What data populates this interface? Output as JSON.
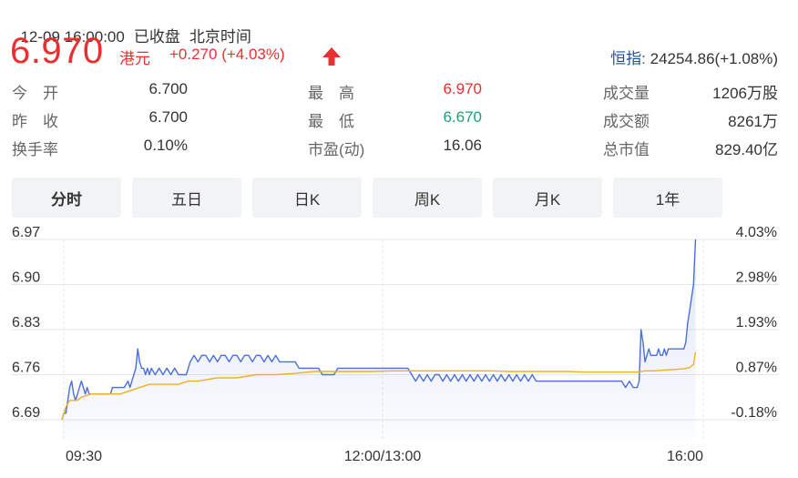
{
  "header": {
    "datetime": "12-09 16:00:00",
    "status": "已收盘",
    "timezone": "北京时间"
  },
  "quote": {
    "price": "6.970",
    "currency": "港元",
    "change": "+0.270 (+4.03%)",
    "direction": "up",
    "index_label": "恒指:",
    "index_value": "24254.86(+1.08%)"
  },
  "stats": [
    {
      "label": "今　开",
      "value": "6.700",
      "color": "#333333"
    },
    {
      "label": "昨　收",
      "value": "6.700",
      "color": "#333333"
    },
    {
      "label": "换手率",
      "value": "0.10%",
      "color": "#333333"
    },
    {
      "label": "最　高",
      "value": "6.970",
      "color": "#e93030"
    },
    {
      "label": "最　低",
      "value": "6.670",
      "color": "#1aa27b"
    },
    {
      "label": "市盈(动)",
      "value": "16.06",
      "color": "#333333"
    },
    {
      "label": "成交量",
      "value": "1206万股",
      "color": "#333333"
    },
    {
      "label": "成交额",
      "value": "8261万",
      "color": "#333333"
    },
    {
      "label": "总市值",
      "value": "829.40亿",
      "color": "#333333"
    }
  ],
  "tabs": [
    {
      "label": "分时",
      "active": true
    },
    {
      "label": "五日",
      "active": false
    },
    {
      "label": "日K",
      "active": false
    },
    {
      "label": "周K",
      "active": false
    },
    {
      "label": "月K",
      "active": false
    },
    {
      "label": "1年",
      "active": false
    }
  ],
  "colors": {
    "up": "#e93030",
    "down": "#1aa27b",
    "price_line": "#4a6fdc",
    "avg_line": "#f2b01e",
    "grid": "#e6e6e6"
  },
  "chart_data": {
    "type": "line",
    "y_ticks_left": [
      "6.97",
      "6.90",
      "6.83",
      "6.76",
      "6.69"
    ],
    "y_ticks_right": [
      "4.03%",
      "2.98%",
      "1.93%",
      "0.87%",
      "-0.18%"
    ],
    "ylim": [
      6.69,
      6.97
    ],
    "x_ticks": [
      "09:30",
      "12:00/13:00",
      "16:00"
    ],
    "x_range_minutes": [
      0,
      330
    ],
    "grid": true,
    "series": [
      {
        "role": "price",
        "points": [
          [
            0,
            6.69
          ],
          [
            1,
            6.7
          ],
          [
            2,
            6.7
          ],
          [
            3,
            6.72
          ],
          [
            4,
            6.74
          ],
          [
            5,
            6.75
          ],
          [
            6,
            6.73
          ],
          [
            7,
            6.72
          ],
          [
            8,
            6.73
          ],
          [
            9,
            6.74
          ],
          [
            10,
            6.75
          ],
          [
            11,
            6.74
          ],
          [
            12,
            6.73
          ],
          [
            13,
            6.74
          ],
          [
            14,
            6.73
          ],
          [
            15,
            6.73
          ],
          [
            18,
            6.73
          ],
          [
            20,
            6.73
          ],
          [
            22,
            6.73
          ],
          [
            25,
            6.73
          ],
          [
            26,
            6.74
          ],
          [
            28,
            6.74
          ],
          [
            30,
            6.74
          ],
          [
            32,
            6.74
          ],
          [
            34,
            6.75
          ],
          [
            35,
            6.74
          ],
          [
            36,
            6.75
          ],
          [
            37,
            6.76
          ],
          [
            38,
            6.77
          ],
          [
            39,
            6.8
          ],
          [
            40,
            6.78
          ],
          [
            41,
            6.77
          ],
          [
            42,
            6.77
          ],
          [
            43,
            6.76
          ],
          [
            44,
            6.77
          ],
          [
            45,
            6.76
          ],
          [
            46,
            6.77
          ],
          [
            48,
            6.76
          ],
          [
            50,
            6.77
          ],
          [
            52,
            6.76
          ],
          [
            54,
            6.77
          ],
          [
            56,
            6.76
          ],
          [
            58,
            6.77
          ],
          [
            60,
            6.76
          ],
          [
            62,
            6.76
          ],
          [
            64,
            6.76
          ],
          [
            66,
            6.78
          ],
          [
            68,
            6.79
          ],
          [
            70,
            6.78
          ],
          [
            72,
            6.79
          ],
          [
            74,
            6.79
          ],
          [
            76,
            6.78
          ],
          [
            78,
            6.79
          ],
          [
            80,
            6.78
          ],
          [
            82,
            6.79
          ],
          [
            84,
            6.79
          ],
          [
            86,
            6.78
          ],
          [
            88,
            6.79
          ],
          [
            90,
            6.79
          ],
          [
            92,
            6.78
          ],
          [
            94,
            6.79
          ],
          [
            96,
            6.79
          ],
          [
            98,
            6.78
          ],
          [
            100,
            6.79
          ],
          [
            102,
            6.79
          ],
          [
            104,
            6.78
          ],
          [
            106,
            6.79
          ],
          [
            108,
            6.78
          ],
          [
            110,
            6.79
          ],
          [
            112,
            6.78
          ],
          [
            114,
            6.78
          ],
          [
            116,
            6.78
          ],
          [
            118,
            6.78
          ],
          [
            120,
            6.78
          ],
          [
            122,
            6.77
          ],
          [
            124,
            6.77
          ],
          [
            126,
            6.77
          ],
          [
            128,
            6.77
          ],
          [
            130,
            6.77
          ],
          [
            132,
            6.77
          ],
          [
            134,
            6.76
          ],
          [
            136,
            6.76
          ],
          [
            138,
            6.76
          ],
          [
            140,
            6.76
          ],
          [
            142,
            6.77
          ],
          [
            144,
            6.77
          ],
          [
            146,
            6.77
          ],
          [
            148,
            6.77
          ],
          [
            150,
            6.77
          ],
          [
            152,
            6.77
          ],
          [
            154,
            6.77
          ],
          [
            156,
            6.77
          ],
          [
            158,
            6.77
          ],
          [
            160,
            6.77
          ],
          [
            162,
            6.77
          ],
          [
            164,
            6.77
          ],
          [
            166,
            6.77
          ],
          [
            168,
            6.77
          ],
          [
            170,
            6.77
          ],
          [
            172,
            6.77
          ],
          [
            174,
            6.77
          ],
          [
            176,
            6.77
          ],
          [
            178,
            6.77
          ],
          [
            180,
            6.76
          ],
          [
            182,
            6.75
          ],
          [
            184,
            6.76
          ],
          [
            186,
            6.75
          ],
          [
            188,
            6.76
          ],
          [
            190,
            6.75
          ],
          [
            192,
            6.76
          ],
          [
            194,
            6.76
          ],
          [
            196,
            6.75
          ],
          [
            198,
            6.76
          ],
          [
            200,
            6.75
          ],
          [
            202,
            6.76
          ],
          [
            204,
            6.75
          ],
          [
            206,
            6.76
          ],
          [
            208,
            6.75
          ],
          [
            210,
            6.76
          ],
          [
            212,
            6.75
          ],
          [
            214,
            6.76
          ],
          [
            216,
            6.75
          ],
          [
            218,
            6.76
          ],
          [
            220,
            6.75
          ],
          [
            222,
            6.76
          ],
          [
            224,
            6.75
          ],
          [
            226,
            6.76
          ],
          [
            228,
            6.75
          ],
          [
            230,
            6.76
          ],
          [
            232,
            6.75
          ],
          [
            234,
            6.76
          ],
          [
            236,
            6.75
          ],
          [
            238,
            6.76
          ],
          [
            240,
            6.75
          ],
          [
            242,
            6.76
          ],
          [
            244,
            6.75
          ],
          [
            246,
            6.75
          ],
          [
            248,
            6.75
          ],
          [
            250,
            6.75
          ],
          [
            252,
            6.75
          ],
          [
            254,
            6.75
          ],
          [
            256,
            6.75
          ],
          [
            258,
            6.75
          ],
          [
            260,
            6.75
          ],
          [
            262,
            6.75
          ],
          [
            264,
            6.75
          ],
          [
            266,
            6.75
          ],
          [
            268,
            6.75
          ],
          [
            270,
            6.75
          ],
          [
            272,
            6.75
          ],
          [
            274,
            6.75
          ],
          [
            276,
            6.75
          ],
          [
            278,
            6.75
          ],
          [
            280,
            6.75
          ],
          [
            282,
            6.75
          ],
          [
            284,
            6.75
          ],
          [
            286,
            6.75
          ],
          [
            288,
            6.75
          ],
          [
            290,
            6.74
          ],
          [
            292,
            6.75
          ],
          [
            294,
            6.74
          ],
          [
            296,
            6.74
          ],
          [
            297,
            6.75
          ],
          [
            298,
            6.83
          ],
          [
            299,
            6.81
          ],
          [
            300,
            6.78
          ],
          [
            301,
            6.79
          ],
          [
            302,
            6.8
          ],
          [
            303,
            6.79
          ],
          [
            304,
            6.79
          ],
          [
            305,
            6.79
          ],
          [
            306,
            6.79
          ],
          [
            307,
            6.8
          ],
          [
            308,
            6.79
          ],
          [
            309,
            6.79
          ],
          [
            310,
            6.8
          ],
          [
            311,
            6.79
          ],
          [
            312,
            6.8
          ],
          [
            313,
            6.8
          ],
          [
            314,
            6.8
          ],
          [
            315,
            6.8
          ],
          [
            316,
            6.8
          ],
          [
            317,
            6.8
          ],
          [
            318,
            6.8
          ],
          [
            319,
            6.8
          ],
          [
            320,
            6.8
          ],
          [
            321,
            6.81
          ],
          [
            322,
            6.84
          ],
          [
            323,
            6.86
          ],
          [
            324,
            6.88
          ],
          [
            325,
            6.9
          ],
          [
            326,
            6.97
          ]
        ]
      },
      {
        "role": "average",
        "points": [
          [
            0,
            6.69
          ],
          [
            2,
            6.71
          ],
          [
            4,
            6.72
          ],
          [
            6,
            6.72
          ],
          [
            8,
            6.72
          ],
          [
            10,
            6.725
          ],
          [
            15,
            6.73
          ],
          [
            20,
            6.73
          ],
          [
            25,
            6.73
          ],
          [
            30,
            6.73
          ],
          [
            35,
            6.735
          ],
          [
            40,
            6.74
          ],
          [
            45,
            6.745
          ],
          [
            50,
            6.745
          ],
          [
            55,
            6.745
          ],
          [
            60,
            6.745
          ],
          [
            65,
            6.75
          ],
          [
            70,
            6.75
          ],
          [
            80,
            6.755
          ],
          [
            90,
            6.755
          ],
          [
            100,
            6.76
          ],
          [
            110,
            6.76
          ],
          [
            120,
            6.762
          ],
          [
            130,
            6.765
          ],
          [
            140,
            6.765
          ],
          [
            150,
            6.765
          ],
          [
            160,
            6.765
          ],
          [
            170,
            6.766
          ],
          [
            180,
            6.766
          ],
          [
            190,
            6.766
          ],
          [
            200,
            6.766
          ],
          [
            210,
            6.766
          ],
          [
            220,
            6.766
          ],
          [
            230,
            6.765
          ],
          [
            240,
            6.765
          ],
          [
            250,
            6.765
          ],
          [
            260,
            6.765
          ],
          [
            270,
            6.764
          ],
          [
            280,
            6.764
          ],
          [
            290,
            6.764
          ],
          [
            296,
            6.764
          ],
          [
            298,
            6.765
          ],
          [
            300,
            6.766
          ],
          [
            305,
            6.766
          ],
          [
            310,
            6.767
          ],
          [
            315,
            6.768
          ],
          [
            320,
            6.769
          ],
          [
            323,
            6.771
          ],
          [
            325,
            6.776
          ],
          [
            326,
            6.795
          ]
        ]
      }
    ]
  }
}
